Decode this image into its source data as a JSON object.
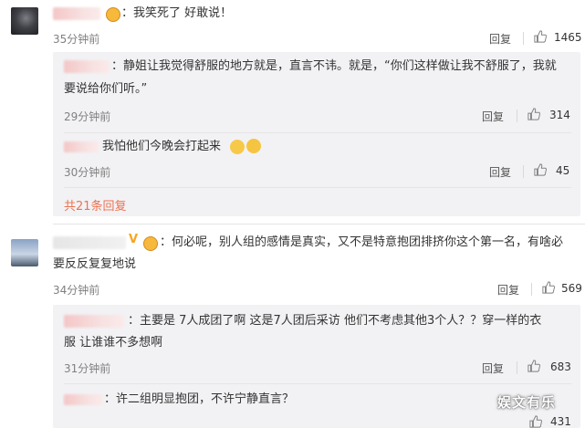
{
  "comments": [
    {
      "text": "：我笑死了 好敢说！",
      "time": "35分钟前",
      "reply_label": "回复",
      "likes": "1465",
      "replies": [
        {
          "text_line1": "：静姐让我觉得舒服的地方就是，直言不讳。就是，“你们这样做让我不舒服了，我就",
          "text_line2": "要说给你们听。”",
          "time": "29分钟前",
          "reply_label": "回复",
          "likes": "314"
        },
        {
          "text": "我怕他们今晚会打起来",
          "time": "30分钟前",
          "reply_label": "回复",
          "likes": "45"
        }
      ],
      "more_replies": "共21条回复"
    },
    {
      "text_line1": "：何必呢，别人组的感情是真实，又不是特意抱团排挤你这个第一名，有啥必",
      "text_line2": "要反反复复地说",
      "badge": "V",
      "time": "34分钟前",
      "reply_label": "回复",
      "likes": "569",
      "replies": [
        {
          "text_line1": "：主要是 7人成团了啊 这是7人团后采访 他们不考虑其他3个人？？穿一样的衣",
          "text_line2": "服 让谁谁不多想啊",
          "time": "31分钟前",
          "reply_label": "回复",
          "likes": "683"
        },
        {
          "text": "：许二组明显抱团，不许宁静直言？",
          "time": "",
          "reply_label": "",
          "likes": "431"
        }
      ]
    }
  ],
  "watermark": "娱文有乐",
  "icons": {
    "like": "thumbs-up-icon",
    "emoji_laugh": "laughing-emoji-icon",
    "emoji_thumb": "thumbs-up-emoji-icon",
    "emoji_cat": "cat-face-emoji-icon"
  },
  "colors": {
    "accent": "#eb7350",
    "reply_bg": "#f2f2f5",
    "badge": "#f5a623"
  }
}
